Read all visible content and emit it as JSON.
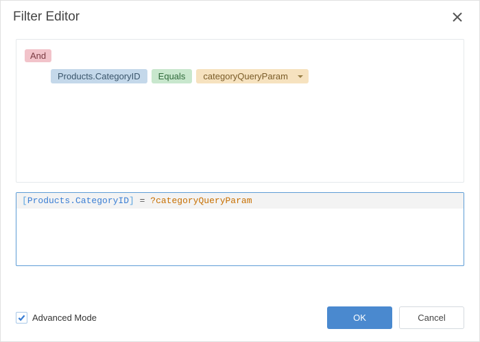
{
  "header": {
    "title": "Filter Editor"
  },
  "filter": {
    "groupOperator": "And",
    "condition": {
      "field": "Products.CategoryID",
      "operator": "Equals",
      "value": "categoryQueryParam"
    }
  },
  "expression": {
    "openBracket": "[",
    "field": "Products.CategoryID",
    "closeBracket": "]",
    "eq": " = ",
    "paramPrefix": "?",
    "param": "categoryQueryParam"
  },
  "footer": {
    "advancedModeLabel": "Advanced Mode",
    "ok": "OK",
    "cancel": "Cancel"
  }
}
